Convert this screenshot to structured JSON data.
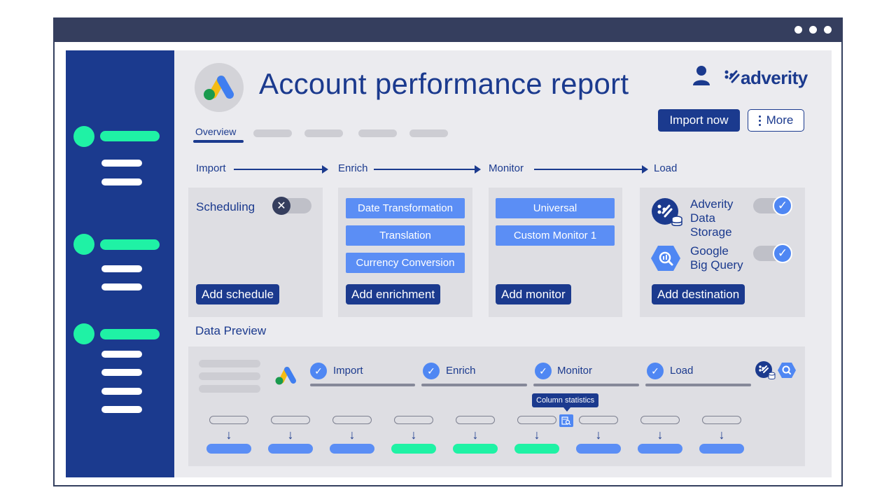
{
  "window": {
    "controls": [
      "dot",
      "dot",
      "dot"
    ]
  },
  "header": {
    "title": "Account performance report",
    "brand": "adverity",
    "import_button": "Import now",
    "more_button": "More"
  },
  "tabs": {
    "active": "Overview"
  },
  "flow": {
    "steps": [
      "Import",
      "Enrich",
      "Monitor",
      "Load"
    ]
  },
  "cards": {
    "import": {
      "label": "Scheduling",
      "toggle_on": false,
      "button": "Add schedule"
    },
    "enrich": {
      "items": [
        "Date Transformation",
        "Translation",
        "Currency Conversion"
      ],
      "button": "Add enrichment"
    },
    "monitor": {
      "items": [
        "Universal",
        "Custom Monitor 1"
      ],
      "button": "Add monitor"
    },
    "load": {
      "destinations": [
        {
          "name_lines": [
            "Adverity",
            "Data",
            "Storage"
          ],
          "icon": "adverity-storage-icon",
          "enabled": true
        },
        {
          "name_lines": [
            "Google",
            "Big Query"
          ],
          "icon": "bigquery-icon",
          "enabled": true
        }
      ],
      "button": "Add destination"
    }
  },
  "data_preview": {
    "label": "Data Preview",
    "steps": [
      "Import",
      "Enrich",
      "Monitor",
      "Load"
    ],
    "tooltip": "Column statistics",
    "column_colors": [
      "blue",
      "blue",
      "blue",
      "green",
      "green",
      "green",
      "blue",
      "blue",
      "blue"
    ]
  },
  "colors": {
    "navy": "#1b3a8e",
    "accent_green": "#1ff2a5",
    "accent_blue": "#5b8ef5",
    "titlebar": "#353e5e"
  }
}
